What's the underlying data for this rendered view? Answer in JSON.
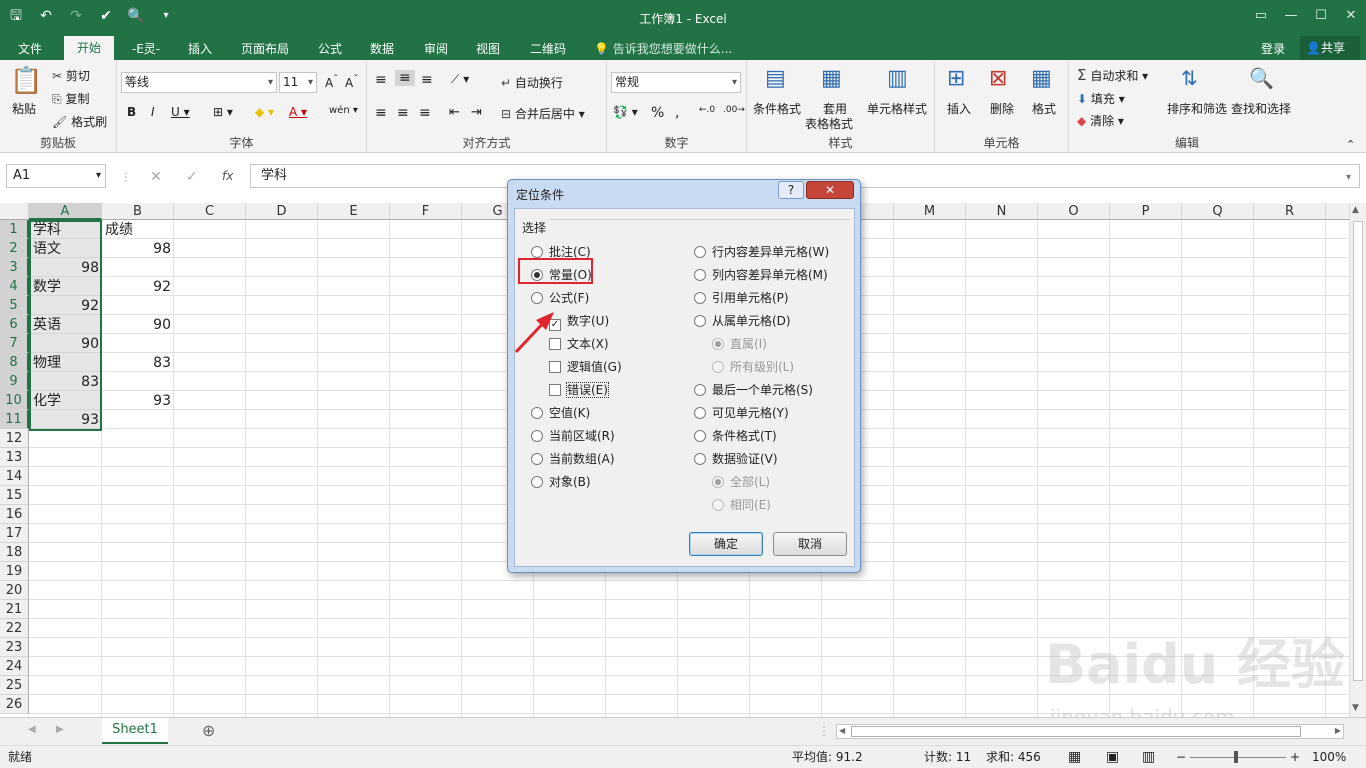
{
  "title_bar": {
    "title": "工作簿1 - Excel"
  },
  "ribbon_tabs": {
    "file": "文件",
    "home": "开始",
    "erling": "-E灵-",
    "insert": "插入",
    "layout": "页面布局",
    "formulas": "公式",
    "data": "数据",
    "review": "审阅",
    "view": "视图",
    "qrcode": "二维码",
    "tell_me": "告诉我您想要做什么...",
    "login": "登录",
    "share": "共享"
  },
  "clipboard": {
    "paste": "粘贴",
    "cut": "剪切",
    "copy": "复制",
    "format_painter": "格式刷",
    "label": "剪贴板"
  },
  "font": {
    "name": "等线",
    "size": "11",
    "label": "字体"
  },
  "alignment": {
    "wrap": "自动换行",
    "merge": "合并后居中",
    "label": "对齐方式"
  },
  "number": {
    "format": "常规",
    "label": "数字"
  },
  "styles": {
    "conditional": "条件格式",
    "table_format": "套用",
    "table_format2": "表格格式",
    "cell_styles": "单元格样式",
    "label": "样式"
  },
  "cells": {
    "insert": "插入",
    "delete": "删除",
    "format": "格式",
    "label": "单元格"
  },
  "editing": {
    "autosum": "自动求和",
    "fill": "填充",
    "clear": "清除",
    "sort": "排序和筛选",
    "find": "查找和选择",
    "label": "编辑"
  },
  "formula_bar": {
    "name_box": "A1",
    "content": "学科"
  },
  "columns": [
    "A",
    "B",
    "C",
    "D",
    "E",
    "F",
    "G",
    "M",
    "N",
    "O",
    "P",
    "Q",
    "R"
  ],
  "rows": [
    "1",
    "2",
    "3",
    "4",
    "5",
    "6",
    "7",
    "8",
    "9",
    "10",
    "11",
    "12",
    "13",
    "14",
    "15",
    "16",
    "17",
    "18",
    "19",
    "20",
    "21",
    "22",
    "23",
    "24",
    "25",
    "26"
  ],
  "cells_data": {
    "a1": "学科",
    "b1": "成绩",
    "a2": "语文",
    "b2": "98",
    "a3": "98",
    "a4": "数学",
    "b4": "92",
    "a5": "92",
    "a6": "英语",
    "b6": "90",
    "a7": "90",
    "a8": "物理",
    "b8": "83",
    "a9": "83",
    "a10": "化学",
    "b10": "93",
    "a11": "93"
  },
  "dialog": {
    "title": "定位条件",
    "help": "?",
    "close": "✕",
    "group_label": "选择",
    "left_options": {
      "comments": "批注(C)",
      "constants": "常量(O)",
      "formulas": "公式(F)",
      "numbers": "数字(U)",
      "text": "文本(X)",
      "logicals": "逻辑值(G)",
      "errors": "错误(E)",
      "blanks": "空值(K)",
      "current_region": "当前区域(R)",
      "current_array": "当前数组(A)",
      "objects": "对象(B)"
    },
    "right_options": {
      "row_diff": "行内容差异单元格(W)",
      "col_diff": "列内容差异单元格(M)",
      "precedents": "引用单元格(P)",
      "dependents": "从属单元格(D)",
      "direct": "直属(I)",
      "all_levels": "所有级别(L)",
      "last_cell": "最后一个单元格(S)",
      "visible": "可见单元格(Y)",
      "cond_format": "条件格式(T)",
      "data_validation": "数据验证(V)",
      "all": "全部(L)",
      "same": "相同(E)"
    },
    "ok": "确定",
    "cancel": "取消",
    "selected_option": "constants",
    "checked": [
      "numbers"
    ]
  },
  "sheet_tabs": {
    "sheet1": "Sheet1"
  },
  "status_bar": {
    "ready": "就绪",
    "average": "平均值: 91.2",
    "count": "计数: 11",
    "sum": "求和: 456",
    "zoom": "100%"
  },
  "watermark": {
    "text": "Baidu 经验",
    "url": "jingyan.baidu.com"
  },
  "colors": {
    "excel_green": "#217346",
    "highlight_red": "#e0262c"
  }
}
